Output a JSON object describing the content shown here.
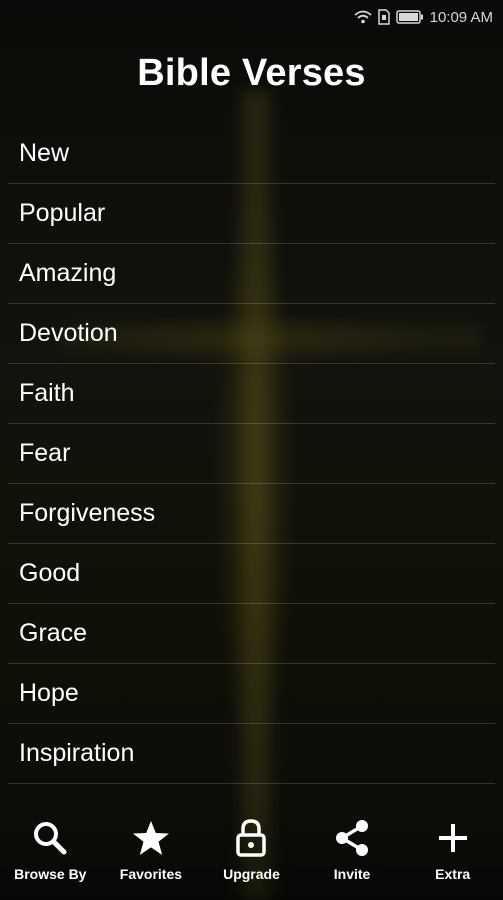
{
  "status_bar": {
    "time": "10:09 AM",
    "icons": [
      "wifi-icon",
      "sim-icon",
      "battery-icon"
    ]
  },
  "header": {
    "title": "Bible Verses"
  },
  "categories": [
    {
      "label": "New"
    },
    {
      "label": "Popular"
    },
    {
      "label": "Amazing"
    },
    {
      "label": "Devotion"
    },
    {
      "label": "Faith"
    },
    {
      "label": "Fear"
    },
    {
      "label": "Forgiveness"
    },
    {
      "label": "Good"
    },
    {
      "label": "Grace"
    },
    {
      "label": "Hope"
    },
    {
      "label": "Inspiration"
    }
  ],
  "bottom_nav": [
    {
      "label": "Browse By",
      "icon": "search-icon"
    },
    {
      "label": "Favorites",
      "icon": "star-icon"
    },
    {
      "label": "Upgrade",
      "icon": "lock-icon"
    },
    {
      "label": "Invite",
      "icon": "share-icon"
    },
    {
      "label": "Extra",
      "icon": "plus-icon"
    }
  ],
  "colors": {
    "text": "#ffffff",
    "background": "#0d0d09",
    "accent_glow": "#6e641e"
  }
}
